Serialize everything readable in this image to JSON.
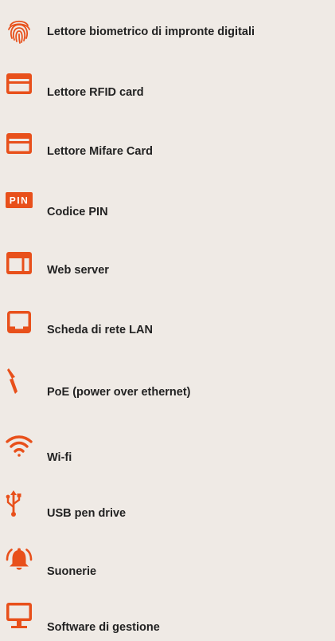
{
  "accent_color": "#e8501b",
  "features": [
    {
      "icon": "fingerprint-icon",
      "label": "Lettore biometrico di impronte digitali"
    },
    {
      "icon": "credit-card-icon",
      "label": "Lettore RFID card"
    },
    {
      "icon": "credit-card-icon",
      "label": "Lettore Mifare Card"
    },
    {
      "icon": "pin-icon",
      "label": "Codice PIN",
      "icon_text": "PIN"
    },
    {
      "icon": "browser-window-icon",
      "label": "Web server"
    },
    {
      "icon": "inbox-tray-icon",
      "label": "Scheda di rete LAN"
    },
    {
      "icon": "lightning-bolt-icon",
      "label": "PoE (power over ethernet)"
    },
    {
      "icon": "wifi-icon",
      "label": "Wi-fi"
    },
    {
      "icon": "usb-icon",
      "label": "USB pen drive"
    },
    {
      "icon": "ringing-bell-icon",
      "label": "Suonerie"
    },
    {
      "icon": "desktop-monitor-icon",
      "label": "Software di gestione"
    }
  ]
}
